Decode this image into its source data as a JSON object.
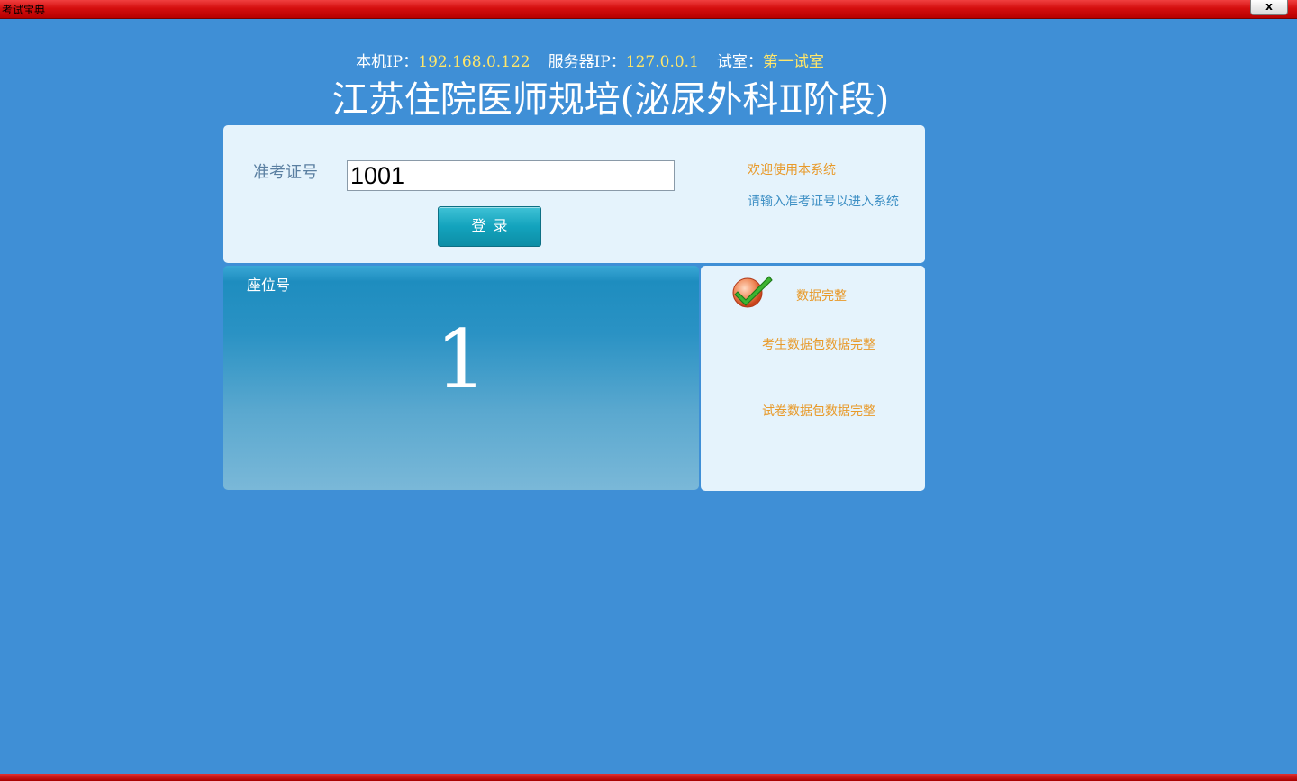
{
  "window": {
    "title": "考试宝典",
    "close_label": "x"
  },
  "info": {
    "local_ip_label": "本机IP：",
    "local_ip": "192.168.0.122",
    "server_ip_label": "服务器IP：",
    "server_ip": "127.0.0.1",
    "room_label": "试室：",
    "room": "第一试室"
  },
  "heading": "江苏住院医师规培(泌尿外科Ⅱ阶段)",
  "login": {
    "ticket_label": "准考证号",
    "ticket_value": "1001",
    "button_label": "登录",
    "welcome": "欢迎使用本系统",
    "hint": "请输入准考证号以进入系统"
  },
  "seat": {
    "label": "座位号",
    "number": "1"
  },
  "status": {
    "main": "数据完整",
    "student_package": "考生数据包数据完整",
    "paper_package": "试卷数据包数据完整",
    "icon": "checkmark-icon"
  },
  "colors": {
    "background": "#3f8fd6",
    "titlebar": "#d40f0f",
    "highlight": "#ffe66a",
    "accent_orange": "#e89a2a",
    "panel": "#e5f3fc",
    "button": "#13a3bd"
  }
}
